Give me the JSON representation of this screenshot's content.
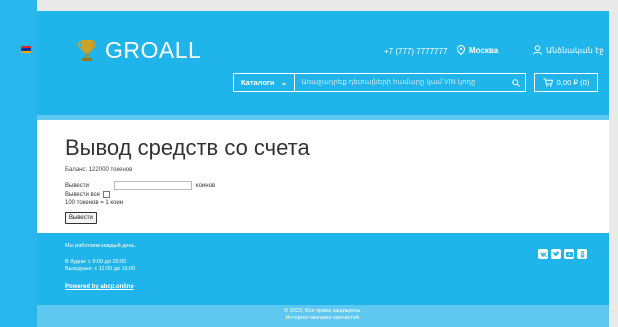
{
  "header": {
    "logo_text": "GROALL",
    "phone": "+7 (777) 7777777",
    "city": "Москва",
    "login": "Անձնական էջ",
    "catalog_label": "Каталоги",
    "search_placeholder": "Առաջադրեք դետալների համարը կամ VIN կոդը",
    "cart_label": "0,00 ₽ (0)"
  },
  "main": {
    "title": "Вывод средств со счета",
    "balance": "Баланс: 122000 токенов",
    "withdraw_label": "Вывести",
    "withdraw_unit": "коинов",
    "withdraw_all_label": "Вывести все",
    "rate": "100 токенов = 1 коин",
    "submit_label": "Вывести"
  },
  "footer": {
    "work_title": "Мы работаем каждый день.",
    "weekdays": "В будни: с 9:00 до 20:00",
    "weekends": "Выходные: с 11:00 до 15:00",
    "powered": "Powered by abcp.online",
    "copyright_1": "© 2023, Все права защищены.",
    "copyright_2": "Интернет-магазин запчастей.",
    "social_icons": [
      "vk-icon",
      "twitter-icon",
      "youtube-icon",
      "odnoklassniki-icon"
    ]
  },
  "colors": {
    "brand_blue": "#1fb4ea",
    "light_blue": "#5ec8f0"
  }
}
